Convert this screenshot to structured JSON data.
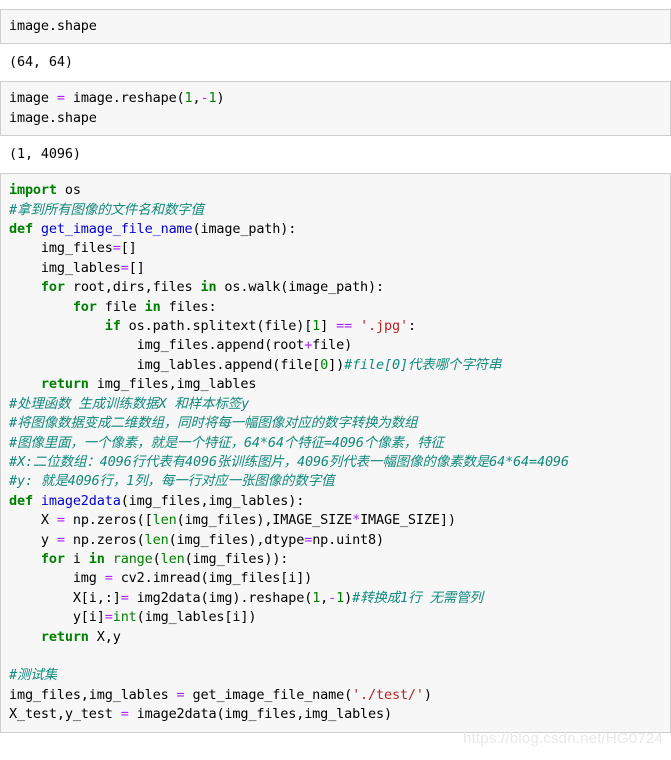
{
  "notebook": {
    "watermark": "https://blog.csdn.net/HG0724",
    "cells": [
      {
        "type": "input",
        "name": "cell-input-1",
        "lines": [
          [
            {
              "t": "image.shape",
              "c": "plain"
            }
          ]
        ]
      },
      {
        "type": "output",
        "name": "cell-output-1",
        "lines": [
          [
            {
              "t": "(64, 64)",
              "c": "plain"
            }
          ]
        ]
      },
      {
        "type": "input",
        "name": "cell-input-2",
        "lines": [
          [
            {
              "t": "image ",
              "c": "plain"
            },
            {
              "t": "=",
              "c": "o"
            },
            {
              "t": " image.reshape(",
              "c": "plain"
            },
            {
              "t": "1",
              "c": "m"
            },
            {
              "t": ",",
              "c": "plain"
            },
            {
              "t": "-",
              "c": "o"
            },
            {
              "t": "1",
              "c": "m"
            },
            {
              "t": ")",
              "c": "plain"
            }
          ],
          [
            {
              "t": "image.shape",
              "c": "plain"
            }
          ]
        ]
      },
      {
        "type": "output",
        "name": "cell-output-2",
        "lines": [
          [
            {
              "t": "(1, 4096)",
              "c": "plain"
            }
          ]
        ]
      },
      {
        "type": "input",
        "name": "cell-input-3",
        "lines": [
          [
            {
              "t": "import",
              "c": "k"
            },
            {
              "t": " os",
              "c": "plain"
            }
          ],
          [
            {
              "t": "#拿到所有图像的文件名和数字值",
              "c": "c"
            }
          ],
          [
            {
              "t": "def",
              "c": "k"
            },
            {
              "t": " ",
              "c": "plain"
            },
            {
              "t": "get_image_file_name",
              "c": "nf"
            },
            {
              "t": "(image_path):",
              "c": "plain"
            }
          ],
          [
            {
              "t": "    img_files",
              "c": "plain"
            },
            {
              "t": "=",
              "c": "o"
            },
            {
              "t": "[]",
              "c": "plain"
            }
          ],
          [
            {
              "t": "    img_lables",
              "c": "plain"
            },
            {
              "t": "=",
              "c": "o"
            },
            {
              "t": "[]",
              "c": "plain"
            }
          ],
          [
            {
              "t": "    ",
              "c": "plain"
            },
            {
              "t": "for",
              "c": "k"
            },
            {
              "t": " root,dirs,files ",
              "c": "plain"
            },
            {
              "t": "in",
              "c": "k"
            },
            {
              "t": " os.walk(image_path):",
              "c": "plain"
            }
          ],
          [
            {
              "t": "        ",
              "c": "plain"
            },
            {
              "t": "for",
              "c": "k"
            },
            {
              "t": " file ",
              "c": "plain"
            },
            {
              "t": "in",
              "c": "k"
            },
            {
              "t": " files:",
              "c": "plain"
            }
          ],
          [
            {
              "t": "            ",
              "c": "plain"
            },
            {
              "t": "if",
              "c": "k"
            },
            {
              "t": " os.path.splitext(file)[",
              "c": "plain"
            },
            {
              "t": "1",
              "c": "m"
            },
            {
              "t": "] ",
              "c": "plain"
            },
            {
              "t": "==",
              "c": "o"
            },
            {
              "t": " ",
              "c": "plain"
            },
            {
              "t": "'.jpg'",
              "c": "s"
            },
            {
              "t": ":",
              "c": "plain"
            }
          ],
          [
            {
              "t": "                img_files.append(root",
              "c": "plain"
            },
            {
              "t": "+",
              "c": "o"
            },
            {
              "t": "file)",
              "c": "plain"
            }
          ],
          [
            {
              "t": "                img_lables.append(file[",
              "c": "plain"
            },
            {
              "t": "0",
              "c": "m"
            },
            {
              "t": "])",
              "c": "plain"
            },
            {
              "t": "#file[0]代表哪个字符串",
              "c": "c"
            }
          ],
          [
            {
              "t": "    ",
              "c": "plain"
            },
            {
              "t": "return",
              "c": "k"
            },
            {
              "t": " img_files,img_lables",
              "c": "plain"
            }
          ],
          [
            {
              "t": "#处理函数 生成训练数据X 和样本标签y",
              "c": "c"
            }
          ],
          [
            {
              "t": "#将图像数据变成二维数组，同时将每一幅图像对应的数字转换为数组",
              "c": "c"
            }
          ],
          [
            {
              "t": "#图像里面，一个像素，就是一个特征，64*64个特征=4096个像素，特征",
              "c": "c"
            }
          ],
          [
            {
              "t": "#X:二位数组：4096行代表有4096张训练图片，4096列代表一幅图像的像素数是64*64=4096",
              "c": "c"
            }
          ],
          [
            {
              "t": "#y: 就是4096行，1列，每一行对应一张图像的数字值",
              "c": "c"
            }
          ],
          [
            {
              "t": "def",
              "c": "k"
            },
            {
              "t": " ",
              "c": "plain"
            },
            {
              "t": "image2data",
              "c": "nf"
            },
            {
              "t": "(img_files,img_lables):",
              "c": "plain"
            }
          ],
          [
            {
              "t": "    X ",
              "c": "plain"
            },
            {
              "t": "=",
              "c": "o"
            },
            {
              "t": " np.zeros([",
              "c": "plain"
            },
            {
              "t": "len",
              "c": "nb"
            },
            {
              "t": "(img_files),IMAGE_SIZE",
              "c": "plain"
            },
            {
              "t": "*",
              "c": "o"
            },
            {
              "t": "IMAGE_SIZE])",
              "c": "plain"
            }
          ],
          [
            {
              "t": "    y ",
              "c": "plain"
            },
            {
              "t": "=",
              "c": "o"
            },
            {
              "t": " np.zeros(",
              "c": "plain"
            },
            {
              "t": "len",
              "c": "nb"
            },
            {
              "t": "(img_files),dtype",
              "c": "plain"
            },
            {
              "t": "=",
              "c": "o"
            },
            {
              "t": "np.uint8)",
              "c": "plain"
            }
          ],
          [
            {
              "t": "    ",
              "c": "plain"
            },
            {
              "t": "for",
              "c": "k"
            },
            {
              "t": " i ",
              "c": "plain"
            },
            {
              "t": "in",
              "c": "k"
            },
            {
              "t": " ",
              "c": "plain"
            },
            {
              "t": "range",
              "c": "nb"
            },
            {
              "t": "(",
              "c": "plain"
            },
            {
              "t": "len",
              "c": "nb"
            },
            {
              "t": "(img_files)):",
              "c": "plain"
            }
          ],
          [
            {
              "t": "        img ",
              "c": "plain"
            },
            {
              "t": "=",
              "c": "o"
            },
            {
              "t": " cv2.imread(img_files[i])",
              "c": "plain"
            }
          ],
          [
            {
              "t": "        X[i,:]",
              "c": "plain"
            },
            {
              "t": "=",
              "c": "o"
            },
            {
              "t": " img2data(img).reshape(",
              "c": "plain"
            },
            {
              "t": "1",
              "c": "m"
            },
            {
              "t": ",",
              "c": "plain"
            },
            {
              "t": "-",
              "c": "o"
            },
            {
              "t": "1",
              "c": "m"
            },
            {
              "t": ")",
              "c": "plain"
            },
            {
              "t": "#转换成1行 无需管列",
              "c": "c"
            }
          ],
          [
            {
              "t": "        y[i]",
              "c": "plain"
            },
            {
              "t": "=",
              "c": "o"
            },
            {
              "t": "int",
              "c": "nb"
            },
            {
              "t": "(img_lables[i])",
              "c": "plain"
            }
          ],
          [
            {
              "t": "    ",
              "c": "plain"
            },
            {
              "t": "return",
              "c": "k"
            },
            {
              "t": " X,y",
              "c": "plain"
            }
          ],
          [
            {
              "t": "",
              "c": "plain"
            }
          ],
          [
            {
              "t": "#测试集",
              "c": "c"
            }
          ],
          [
            {
              "t": "img_files,img_lables ",
              "c": "plain"
            },
            {
              "t": "=",
              "c": "o"
            },
            {
              "t": " get_image_file_name(",
              "c": "plain"
            },
            {
              "t": "'./test/'",
              "c": "s"
            },
            {
              "t": ")",
              "c": "plain"
            }
          ],
          [
            {
              "t": "X_test,y_test ",
              "c": "plain"
            },
            {
              "t": "=",
              "c": "o"
            },
            {
              "t": " image2data(img_files,img_lables)",
              "c": "plain"
            }
          ]
        ]
      }
    ]
  }
}
